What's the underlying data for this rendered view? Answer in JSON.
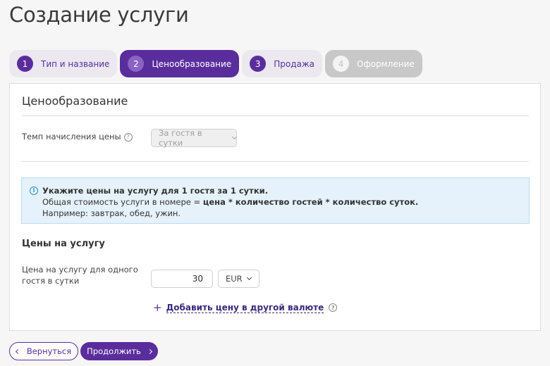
{
  "page": {
    "title": "Создание услуги"
  },
  "steps": [
    {
      "num": "1",
      "label": "Тип и название",
      "state": "done"
    },
    {
      "num": "2",
      "label": "Ценообразование",
      "state": "active"
    },
    {
      "num": "3",
      "label": "Продажа",
      "state": "done"
    },
    {
      "num": "4",
      "label": "Оформление",
      "state": "disabled"
    }
  ],
  "pricing": {
    "section_title": "Ценообразование",
    "rate_label": "Темп начисления цены",
    "rate_value": "За гостя в сутки",
    "help_glyph": "?"
  },
  "info": {
    "icon": "i",
    "line1": "Укажите цены на услугу для 1 гостя за 1 сутки.",
    "line2_prefix": "Общая стоимость услуги в номере = ",
    "line2_formula": "цена * количество гостей * количество суток.",
    "line3": "Например: завтрак, обед, ужин."
  },
  "prices": {
    "title": "Цены на услугу",
    "label_line1": "Цена на услугу для одного",
    "label_line2": "гостя в сутки",
    "value": "30",
    "currency": "EUR",
    "add_plus": "+",
    "add_link": "Добавить цену в другой валюте"
  },
  "footer": {
    "back_label": "Вернуться",
    "next_label": "Продолжить"
  },
  "colors": {
    "accent": "#5a2d9c",
    "info_bg": "#e5f2fb",
    "disabled": "#c8c8c8"
  }
}
